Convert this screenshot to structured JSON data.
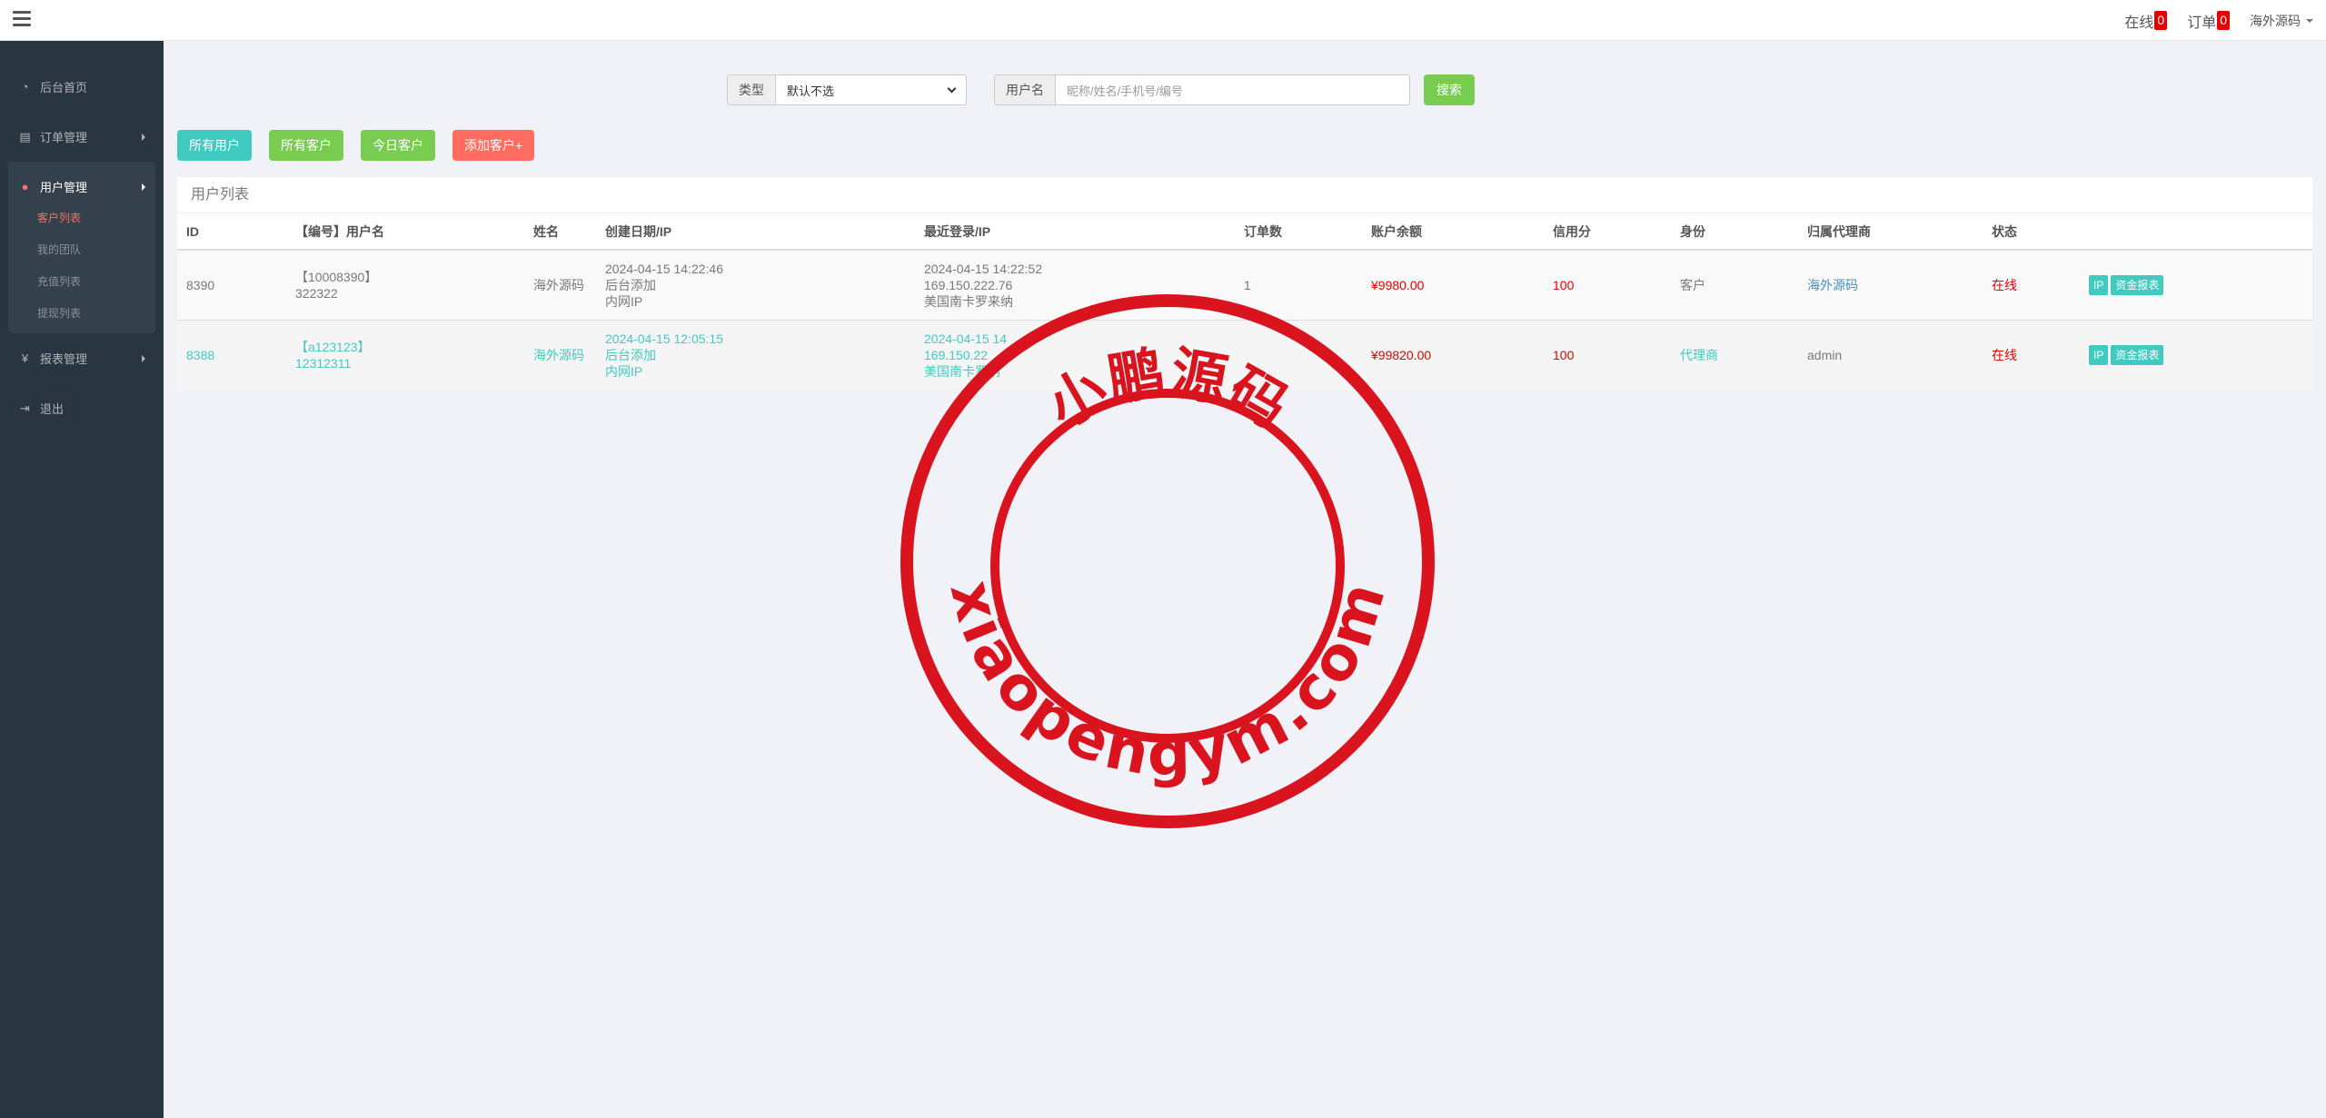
{
  "topbar": {
    "online_label": "在线",
    "online_count": "0",
    "orders_label": "订单",
    "orders_count": "0",
    "user_name": "海外源码"
  },
  "sidebar": {
    "items": [
      {
        "label": "后台首页",
        "icon": "dashboard-icon"
      },
      {
        "label": "订单管理",
        "icon": "orders-icon"
      },
      {
        "label": "用户管理",
        "icon": "user-icon"
      },
      {
        "label": "报表管理",
        "icon": "yen-icon"
      },
      {
        "label": "退出",
        "icon": "logout-icon"
      }
    ],
    "user_sub": [
      "客户列表",
      "我的团队",
      "充值列表",
      "提现列表"
    ]
  },
  "search": {
    "type_label": "类型",
    "type_selected": "默认不选",
    "name_label": "用户名",
    "name_placeholder": "昵称/姓名/手机号/编号",
    "button": "搜索"
  },
  "filters": {
    "all_users": "所有用户",
    "all_customers": "所有客户",
    "today_customers": "今日客户",
    "add_customer": "添加客户+"
  },
  "table": {
    "title": "用户列表",
    "headers": [
      "ID",
      "【编号】用户名",
      "姓名",
      "创建日期/IP",
      "最近登录/IP",
      "订单数",
      "账户余额",
      "信用分",
      "身份",
      "归属代理商",
      "状态"
    ],
    "rows": [
      {
        "id": "8390",
        "code": "【10008390】",
        "username": "322322",
        "name": "海外源码",
        "created_date": "2024-04-15 14:22:46",
        "created_src": "后台添加",
        "created_ip": "内网IP",
        "login_date": "2024-04-15 14:22:52",
        "login_ip": "169.150.222.76",
        "login_loc": "美国南卡罗来纳",
        "orders": "1",
        "balance": "¥9980.00",
        "credit": "100",
        "role": "客户",
        "agent": "海外源码",
        "status": "在线",
        "btn_ip": "IP",
        "btn_report": "资金报表"
      },
      {
        "id": "8388",
        "code": "【a123123】",
        "username": "12312311",
        "name": "海外源码",
        "created_date": "2024-04-15 12:05:15",
        "created_src": "后台添加",
        "created_ip": "内网IP",
        "login_date": "2024-04-15 14",
        "login_ip": "169.150.22",
        "login_loc": "美国南卡罗纳",
        "orders": "",
        "balance": "¥99820.00",
        "credit": "100",
        "role": "代理商",
        "agent": "admin",
        "status": "在线",
        "btn_ip": "IP",
        "btn_report": "资金报表"
      }
    ]
  },
  "watermark": {
    "top_text": "小鹏源码",
    "bottom_text": "xiaopengym.com",
    "color": "#d9141e"
  },
  "colors": {
    "sidebar_bg": "#2a3542",
    "accent_red": "#ff6c60",
    "cyan": "#41cac0",
    "green": "#78cd51"
  }
}
